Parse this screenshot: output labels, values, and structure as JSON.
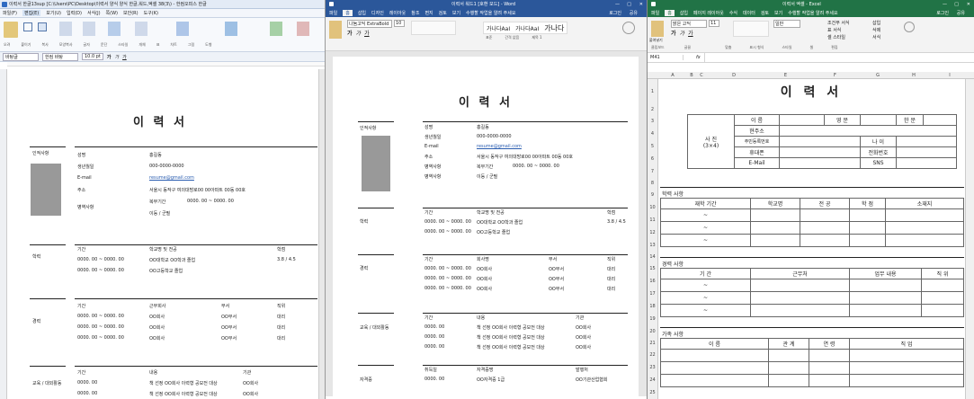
{
  "hwp": {
    "title": "이력서 한글13sup [C:\\Users\\PC\\Desktop\\이력서 양식 양식 한글,워드,엑셀 38(3\\) - 한컴오피스 한글",
    "menus": [
      "파일(F)",
      "편집(E)",
      "보기(U)",
      "입력(D)",
      "서식(J)",
      "쪽(W)",
      "보안(R)",
      "도구(K)"
    ],
    "ribbon": [
      "오려",
      "붙이기",
      "복사",
      "모양복사",
      "글자",
      "문단",
      "스타일",
      "개체",
      "표",
      "차트",
      "그림",
      "도형"
    ],
    "style": "바탕글",
    "font": "한컴 바탕",
    "size": "10.0 pt",
    "doc_title": "이 력 서",
    "s1": "인적사항",
    "info_labels": [
      "성명",
      "생년월일",
      "E-mail",
      "주소",
      "병역사항"
    ],
    "info_values": [
      "홍길동",
      "000-0000-0000",
      "resume@gmail.com",
      "서울시 동작구 여의대방로00 00아파트 00동 00호",
      "복무기간",
      "0000. 00 ~ 0000. 00",
      "이등 / 군필"
    ],
    "s2": "학력",
    "edu_head": [
      "기간",
      "학교명 및 전공",
      "학점"
    ],
    "edu": [
      [
        "0000. 00 ~ 0000. 00",
        "OO대학교 OO학과 졸업",
        "3.8 / 4.5"
      ],
      [
        "0000. 00 ~ 0000. 00",
        "OO고등학교 졸업",
        ""
      ]
    ],
    "s3": "경력",
    "car_head": [
      "기간",
      "근무회사",
      "부서",
      "직위"
    ],
    "car": [
      [
        "0000. 00 ~ 0000. 00",
        "OO회사",
        "OO부서",
        "대리"
      ],
      [
        "0000. 00 ~ 0000. 00",
        "OO회사",
        "OO부서",
        "대리"
      ],
      [
        "0000. 00 ~ 0000. 00",
        "OO회사",
        "OO부서",
        "대리"
      ]
    ],
    "s4": "교육 / 대외활동",
    "act_head": [
      "기간",
      "내용",
      "기관"
    ],
    "act": [
      [
        "0000. 00",
        "책 선정 OO회사 이력형 공모전 대상",
        "OO회사"
      ],
      [
        "0000. 00",
        "책 선정 OO회사 이력형 공모전 대상",
        "OO회사"
      ]
    ]
  },
  "word": {
    "title": "이력서 워드1 [호환 모드] - Word",
    "tabs": [
      "파일",
      "홈",
      "삽입",
      "디자인",
      "레이아웃",
      "참조",
      "편지",
      "검토",
      "보기",
      "수행할 작업을 알려 주세요"
    ],
    "login": "로그인",
    "share": "공유",
    "font": "나눔고딕 ExtraBold",
    "size": "10",
    "styles": [
      "가나다AaI",
      "가나다AaI",
      "가나다"
    ],
    "style_names": [
      "표준",
      "간격 없음",
      "제목 1"
    ],
    "doc_title": "이 력 서",
    "s1": "인적사항",
    "info_labels": [
      "성명",
      "생년월일",
      "E-mail",
      "주소",
      "병역사항",
      "병역사항"
    ],
    "info_values": [
      "홍길동",
      "000-0000-0000",
      "resume@gmail.com",
      "서울시 동작구 여의대방로00 00아파트 00동 00호",
      "복무기간",
      "0000. 00 ~ 0000. 00",
      "이등 / 군필"
    ],
    "s2": "학력",
    "edu_head": [
      "기간",
      "학교명 및 전공",
      "학점"
    ],
    "edu": [
      [
        "0000. 00 ~ 0000. 00",
        "OO대학교 OO학과 졸업",
        "3.8 / 4.5"
      ],
      [
        "0000. 00 ~ 0000. 00",
        "OO고등학교 졸업",
        ""
      ]
    ],
    "s3": "경력",
    "car_head": [
      "기간",
      "회사명",
      "부서",
      "직위"
    ],
    "car": [
      [
        "0000. 00 ~ 0000. 00",
        "OO회사",
        "OO부서",
        "대리"
      ],
      [
        "0000. 00 ~ 0000. 00",
        "OO회사",
        "OO부서",
        "대리"
      ],
      [
        "0000. 00 ~ 0000. 00",
        "OO회사",
        "OO부서",
        "대리"
      ]
    ],
    "s4": "교육 / 대외활동",
    "act_head": [
      "기간",
      "내용",
      "기관"
    ],
    "act": [
      [
        "0000. 00",
        "책 선정 OO회사 이력형 공모전 대상",
        "OO회사"
      ],
      [
        "0000. 00",
        "책 선정 OO회사 이력형 공모전 대상",
        "OO회사"
      ],
      [
        "0000. 00",
        "책 선정 OO회사 이력형 공모전 대상",
        "OO회사"
      ]
    ],
    "s5": "자격증",
    "cert_head": [
      "취득일",
      "자격증명",
      "발행처"
    ],
    "cert": [
      [
        "0000. 00",
        "OO자격증 1급",
        "OO기관산업협회"
      ]
    ]
  },
  "excel": {
    "title": "이력서 엑셀 - Excel",
    "tabs": [
      "파일",
      "홈",
      "삽입",
      "페이지 레이아웃",
      "수식",
      "데이터",
      "검토",
      "보기",
      "수행할 작업을 알려 주세요"
    ],
    "login": "로그인",
    "share": "공유",
    "name_box": "M41",
    "fx": "fx",
    "font": "맑은 고딕",
    "size": "11",
    "groups": [
      "클립보드",
      "글꼴",
      "맞춤",
      "표시 형식",
      "스타일",
      "셀",
      "편집"
    ],
    "ribbon_items": [
      "붙여넣기",
      "일반",
      "조건부 서식",
      "표 서식",
      "셀 스타일",
      "삽입",
      "삭제",
      "서식"
    ],
    "cols": [
      "A",
      "B",
      "C",
      "D",
      "E",
      "F",
      "G",
      "H",
      "I"
    ],
    "rows": [
      "1",
      "2",
      "3",
      "4",
      "5",
      "6",
      "7",
      "8",
      "9",
      "10",
      "11",
      "12",
      "13",
      "14",
      "15",
      "16",
      "17",
      "18",
      "19",
      "20",
      "21",
      "22",
      "23",
      "24",
      "25",
      "26"
    ],
    "doc_title": "이 력 서",
    "photo": "사 진",
    "photo_size": "(3×4)",
    "info": [
      "이 름",
      "영 문",
      "한 문",
      "현주소",
      "주민등록번호",
      "나 이",
      "휴대폰",
      "전화번호",
      "E-Mail",
      "SNS"
    ],
    "s1": "학력 사항",
    "edu_head": [
      "재학 기간",
      "학교명",
      "전 공",
      "학 점",
      "소재지"
    ],
    "tilde": "~",
    "s2": "경력 사항",
    "car_head": [
      "기 간",
      "근무처",
      "업무 내용",
      "직 위"
    ],
    "s3": "가족 사항",
    "fam_head": [
      "이 름",
      "관 계",
      "연 령",
      "직 업"
    ]
  }
}
